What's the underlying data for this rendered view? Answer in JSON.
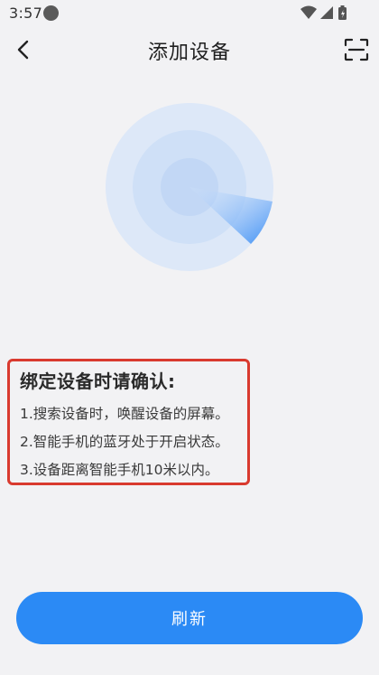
{
  "status_bar": {
    "time": "3:57",
    "icons": [
      "notification-dot-icon",
      "wifi-icon",
      "signal-icon",
      "battery-icon"
    ]
  },
  "header": {
    "title": "添加设备",
    "back_icon": "back-chevron-icon",
    "scan_icon": "scan-icon"
  },
  "radar": {
    "icon": "radar-scanning-icon",
    "colors": {
      "outer": "#dde8f8",
      "middle": "#cfe0f7",
      "inner": "#c2d7f5",
      "sweep": "#3d8ff5"
    }
  },
  "tips": {
    "title": "绑定设备时请确认:",
    "items": [
      "1.搜索设备时，唤醒设备的屏幕。",
      "2.智能手机的蓝牙处于开启状态。",
      "3.设备距离智能手机10米以内。"
    ],
    "border_color": "#d93a2f"
  },
  "actions": {
    "refresh_label": "刷新",
    "accent": "#2b8af5"
  }
}
